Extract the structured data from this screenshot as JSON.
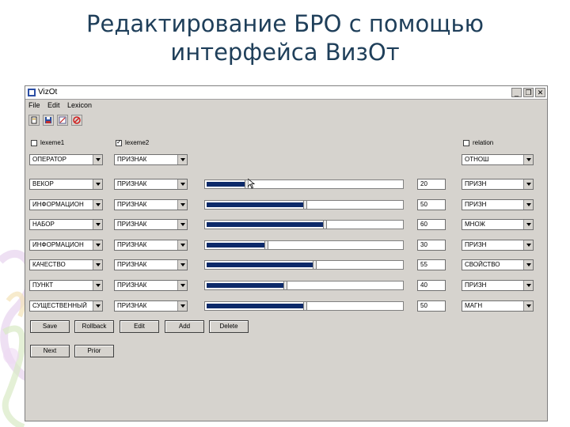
{
  "slide": {
    "title_line1": "Редактирование БРО с помощью",
    "title_line2": "интерфейса ВизОт"
  },
  "window": {
    "title": "VizOt",
    "menu": [
      "File",
      "Edit",
      "Lexicon"
    ],
    "toolbar_icons": [
      "new-file-icon",
      "save-icon",
      "edit-icon",
      "stop-icon"
    ],
    "controls": {
      "minimize": "_",
      "restore": "❐",
      "close": "✕"
    }
  },
  "header": {
    "lexeme1": {
      "label": "lexeme1",
      "checked": false
    },
    "lexeme2": {
      "label": "lexeme2",
      "checked": true
    },
    "relation": {
      "label": "relation",
      "checked": false
    },
    "combo_left": "ОПЕРАТОР",
    "combo_mid": "ПРИЗНАК",
    "combo_right": "ОТНОШ"
  },
  "rows": [
    {
      "lexeme1": "ВЕКОР",
      "lexeme2": "ПРИЗНАК",
      "value": "20",
      "fill": 0.2,
      "relation": "ПРИЗН"
    },
    {
      "lexeme1": "ИНФОРМАЦИОН",
      "lexeme2": "ПРИЗНАК",
      "value": "50",
      "fill": 0.5,
      "relation": "ПРИЗН"
    },
    {
      "lexeme1": "НАБОР",
      "lexeme2": "ПРИЗНАК",
      "value": "60",
      "fill": 0.6,
      "relation": "МНОЖ"
    },
    {
      "lexeme1": "ИНФОРМАЦИОН",
      "lexeme2": "ПРИЗНАК",
      "value": "30",
      "fill": 0.3,
      "relation": "ПРИЗН"
    },
    {
      "lexeme1": "КАЧЕСТВО",
      "lexeme2": "ПРИЗНАК",
      "value": "55",
      "fill": 0.55,
      "relation": "СВОЙСТВО"
    },
    {
      "lexeme1": "ПУНКТ",
      "lexeme2": "ПРИЗНАК",
      "value": "40",
      "fill": 0.4,
      "relation": "ПРИЗН"
    },
    {
      "lexeme1": "СУЩЕСТВЕННЫЙ",
      "lexeme2": "ПРИЗНАК",
      "value": "50",
      "fill": 0.5,
      "relation": "МАГН"
    }
  ],
  "buttons_row1": [
    "Save",
    "Rollback",
    "Edit",
    "Add",
    "Delete"
  ],
  "buttons_row2": [
    "Next",
    "Prior"
  ]
}
